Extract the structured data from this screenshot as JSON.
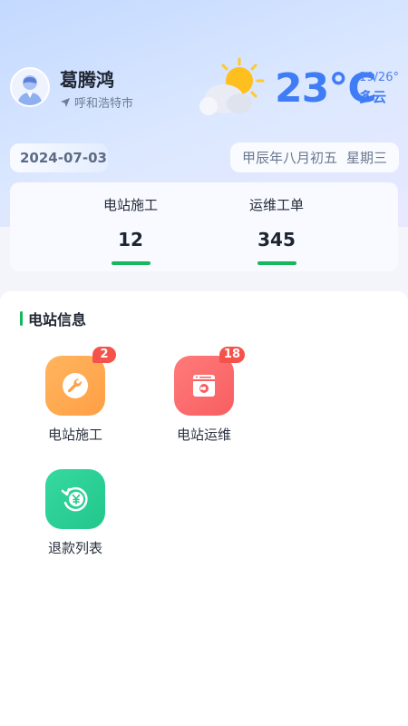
{
  "user": {
    "name": "葛腾鸿",
    "location": "呼和浩特市"
  },
  "weather": {
    "temperature": "23℃",
    "range": "19/26°",
    "description": "多云"
  },
  "date": {
    "solar": "2024-07-03",
    "lunar": "甲辰年八月初五",
    "weekday": "星期三"
  },
  "stats": [
    {
      "label": "电站施工",
      "value": "12"
    },
    {
      "label": "运维工单",
      "value": "345"
    }
  ],
  "section": {
    "title": "电站信息",
    "items": [
      {
        "label": "电站施工",
        "badge": "2",
        "icon": "wrench-icon"
      },
      {
        "label": "电站运维",
        "badge": "18",
        "icon": "maintenance-icon"
      },
      {
        "label": "退款列表",
        "badge": "",
        "icon": "refund-icon"
      }
    ]
  },
  "colors": {
    "accent_green": "#16b85e",
    "temp_blue": "#3f7cf6",
    "tile_orange": "#ffa84f",
    "tile_red": "#fb6a6a",
    "tile_teal": "#2fcf98",
    "badge_red": "#f4524b"
  }
}
